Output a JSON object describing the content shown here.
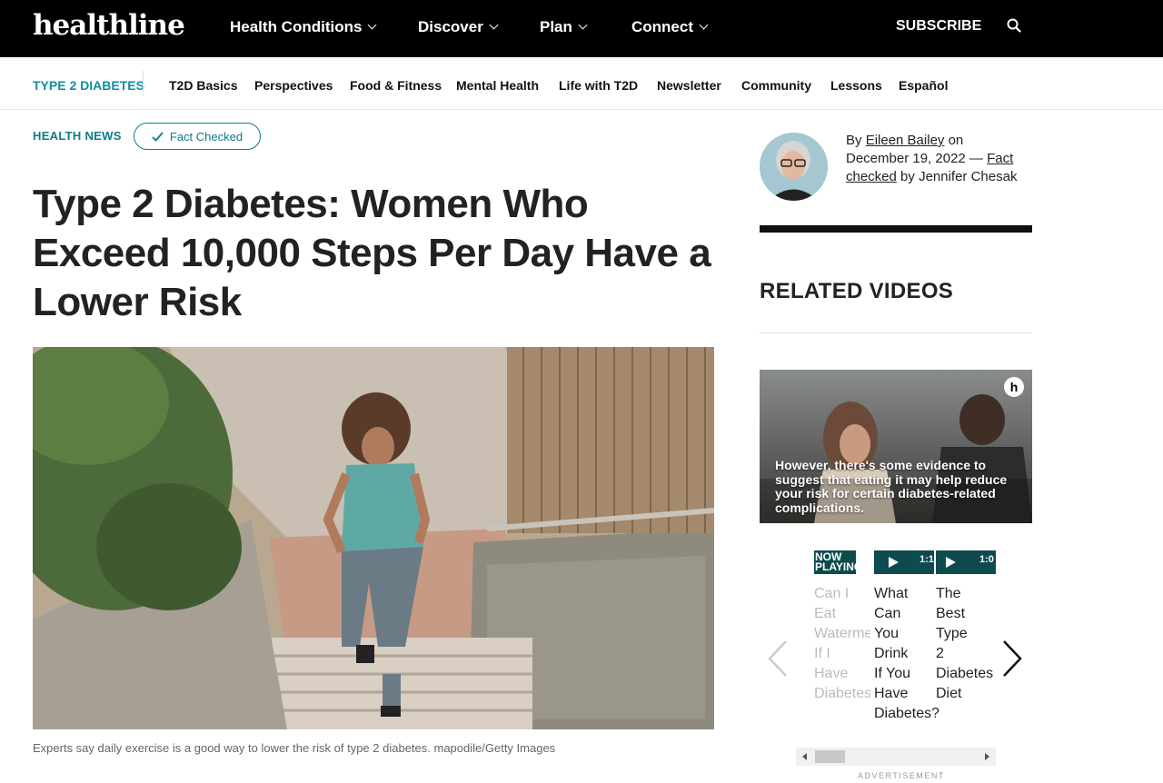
{
  "header": {
    "logo": "healthline",
    "nav": [
      "Health Conditions",
      "Discover",
      "Plan",
      "Connect"
    ],
    "subscribe": "SUBSCRIBE"
  },
  "subnav": {
    "section": "TYPE 2 DIABETES",
    "items": [
      "T2D Basics",
      "Perspectives",
      "Food & Fitness",
      "Mental Health",
      "Life with T2D",
      "Newsletter",
      "Community",
      "Lessons",
      "Español"
    ]
  },
  "article": {
    "category": "HEALTH NEWS",
    "badge": "Fact Checked",
    "headline": "Type 2 Diabetes: Women Who Exceed 10,000 Steps Per Day Have a Lower Risk",
    "caption": "Experts say daily exercise is a good way to lower the risk of type 2 diabetes. mapodile/Getty Images"
  },
  "byline": {
    "by": "By",
    "author": "Eileen Bailey",
    "on": "on",
    "date": "December 19, 2022",
    "dash": "—",
    "fact_checked": "Fact checked",
    "by2": "by",
    "checker": "Jennifer Chesak"
  },
  "sidebar": {
    "related_title": "RELATED VIDEOS",
    "video_caption": "However, there's some evidence to suggest that eating it may help reduce your risk for certain diabetes-related complications.",
    "video_badge": "h",
    "thumbs": [
      "NOW PLAYING",
      "1:1",
      "1:0"
    ],
    "cards": [
      "Can I\nEat\nWatermelon\nIf I\nHave\nDiabetes?",
      "What\nCan\nYou\nDrink\nIf You\nHave\nDiabetes?",
      "The\nBest\nType\n2\nDiabetes\nDiet"
    ],
    "advertisement": "ADVERTISEMENT"
  },
  "colors": {
    "accent": "#0f8fa1",
    "header_bg": "#000000"
  }
}
